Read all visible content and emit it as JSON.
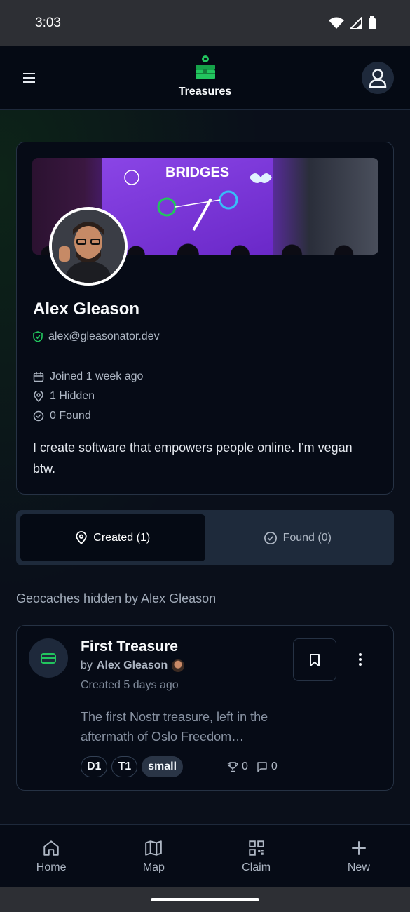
{
  "status_bar": {
    "time": "3:03"
  },
  "header": {
    "title": "Treasures"
  },
  "profile": {
    "banner_text": "BRIDGES",
    "name": "Alex Gleason",
    "nip05": "alex@gleasonator.dev",
    "joined": "Joined 1 week ago",
    "hidden": "1 Hidden",
    "found": "0 Found",
    "bio": "I create software that empowers people online.  I'm vegan btw."
  },
  "tabs": [
    {
      "label": "Created (1)",
      "active": true
    },
    {
      "label": "Found (0)",
      "active": false
    }
  ],
  "section_heading": "Geocaches hidden by Alex Gleason",
  "caches": [
    {
      "title": "First Treasure",
      "by_prefix": "by",
      "author": "Alex Gleason",
      "created": "Created 5 days ago",
      "description": "The first Nostr treasure, left in the aftermath of Oslo Freedom…",
      "badges": [
        "D1",
        "T1",
        "small"
      ],
      "trophies": "0",
      "comments": "0"
    }
  ],
  "bottom_nav": [
    {
      "label": "Home",
      "icon": "home-icon"
    },
    {
      "label": "Map",
      "icon": "map-icon"
    },
    {
      "label": "Claim",
      "icon": "qr-icon"
    },
    {
      "label": "New",
      "icon": "plus-icon"
    }
  ],
  "colors": {
    "accent_green": "#22c55e",
    "background": "#0a0f1a",
    "card": "#060b16"
  }
}
